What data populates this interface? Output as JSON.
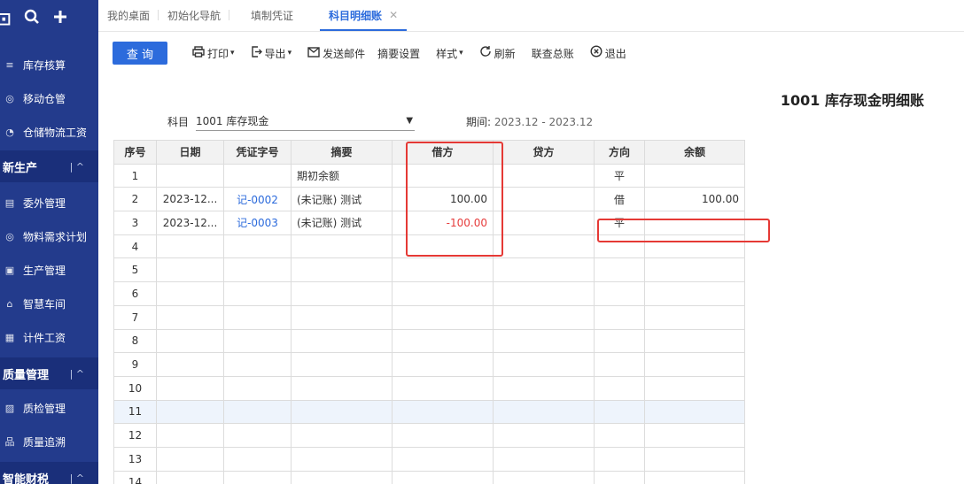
{
  "sidebar": {
    "top_icons": [
      "台",
      "search-icon",
      "plus-icon"
    ],
    "items": [
      {
        "label": "库存核算",
        "icon": "≡"
      },
      {
        "label": "移动仓管",
        "icon": "◎"
      },
      {
        "label": "仓储物流工资",
        "icon": "◔"
      }
    ],
    "group_production": {
      "label": "新生产",
      "caret": "| ^"
    },
    "production_items": [
      {
        "label": "委外管理",
        "icon": "▤"
      },
      {
        "label": "物料需求计划",
        "icon": "◎"
      },
      {
        "label": "生产管理",
        "icon": "▣"
      },
      {
        "label": "智慧车间",
        "icon": "⌂"
      },
      {
        "label": "计件工资",
        "icon": "▦"
      }
    ],
    "group_quality": {
      "label": "质量管理",
      "caret": "| ^"
    },
    "quality_items": [
      {
        "label": "质检管理",
        "icon": "▨"
      },
      {
        "label": "质量追溯",
        "icon": "品"
      }
    ],
    "group_finance": {
      "label": "智能财税",
      "caret": "| ^"
    }
  },
  "tabs": [
    {
      "label": "我的桌面"
    },
    {
      "label": "初始化导航"
    },
    {
      "label": "填制凭证"
    },
    {
      "label": "科目明细账",
      "close": "✕"
    }
  ],
  "toolbar": {
    "query": "查 询",
    "print": "打印",
    "export": "导出",
    "send_mail": "发送邮件",
    "summary_settings": "摘要设置",
    "style": "样式",
    "refresh": "刷新",
    "linked_ledger": "联查总账",
    "exit": "退出"
  },
  "page": {
    "title": "1001 库存现金明细账",
    "subject_label": "科目",
    "subject_value": "1001 库存现金",
    "period_label": "期间:",
    "period_value": "2023.12 - 2023.12"
  },
  "table": {
    "headers": [
      "序号",
      "日期",
      "凭证字号",
      "摘要",
      "借方",
      "贷方",
      "方向",
      "余额"
    ],
    "rows": [
      {
        "seq": "1",
        "date": "",
        "voucher": "",
        "summary": "期初余额",
        "debit": "",
        "credit": "",
        "direction": "平",
        "balance": ""
      },
      {
        "seq": "2",
        "date": "2023-12...",
        "voucher": "记-0002",
        "summary": "(未记账) 测试",
        "debit": "100.00",
        "credit": "",
        "direction": "借",
        "balance": "100.00"
      },
      {
        "seq": "3",
        "date": "2023-12...",
        "voucher": "记-0003",
        "summary": "(未记账) 测试",
        "debit": "-100.00",
        "credit": "",
        "direction": "平",
        "balance": ""
      },
      {
        "seq": "4"
      },
      {
        "seq": "5"
      },
      {
        "seq": "6"
      },
      {
        "seq": "7"
      },
      {
        "seq": "8"
      },
      {
        "seq": "9"
      },
      {
        "seq": "10"
      },
      {
        "seq": "11"
      },
      {
        "seq": "12"
      },
      {
        "seq": "13"
      },
      {
        "seq": "14"
      }
    ],
    "highlighted_row": "11"
  },
  "colors": {
    "sidebar": "#233b8c",
    "accent": "#2c6bdc",
    "negative": "#e63b3b",
    "annotation": "#e53935"
  }
}
